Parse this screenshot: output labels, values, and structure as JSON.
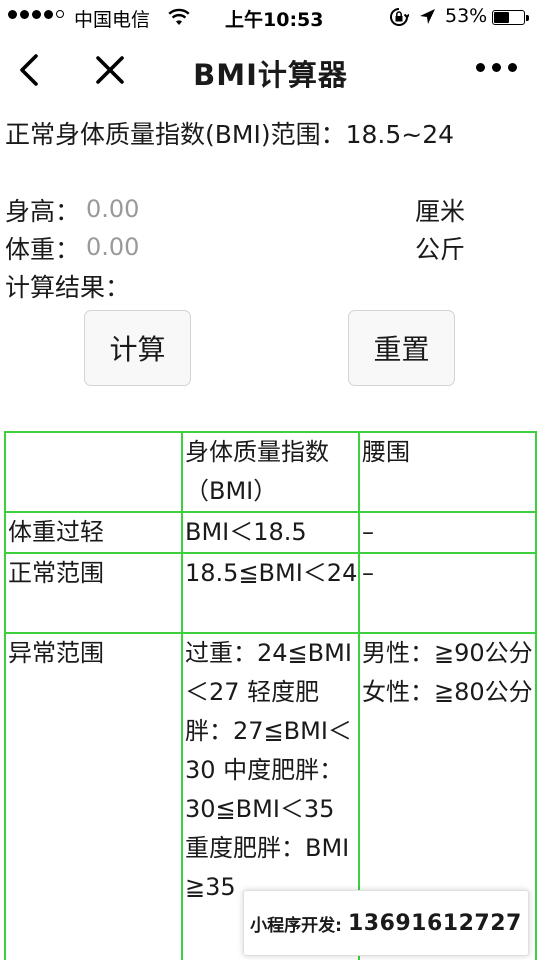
{
  "status_bar": {
    "signal_icon": "signal-dots-icon",
    "carrier": "中国电信",
    "wifi_icon": "wifi-icon",
    "time": "上午10:53",
    "lock_icon": "orientation-lock-icon",
    "location_icon": "location-arrow-icon",
    "battery_percent": "53%",
    "battery_level": 0.53
  },
  "nav": {
    "back_icon": "chevron-left-icon",
    "close_icon": "close-icon",
    "title": "BMI计算器",
    "more_icon": "more-dots-icon"
  },
  "info": {
    "range_text": "正常身体质量指数(BMI)范围：18.5~24"
  },
  "form": {
    "height_label": "身高：",
    "height_placeholder": "0.00",
    "height_unit": "厘米",
    "weight_label": "体重：",
    "weight_placeholder": "0.00",
    "weight_unit": "公斤",
    "result_label": "计算结果：",
    "calc_button": "计算",
    "reset_button": "重置"
  },
  "table": {
    "header": [
      "",
      "身体质量指数（BMI）",
      "腰围"
    ],
    "rows": [
      [
        "体重过轻",
        "BMI＜18.5",
        "–"
      ],
      [
        "正常范围",
        "18.5≦BMI＜24",
        "–"
      ],
      [
        "异常范围",
        "过重：24≦BMI＜27 轻度肥胖：27≦BMI＜30 中度肥胖：30≦BMI＜35 重度肥胖：BMI≧35",
        "男性：≧90公分 女性：≧80公分"
      ]
    ]
  },
  "footer": {
    "label": "小程序开发:",
    "phone": "13691612727"
  },
  "colors": {
    "table_border": "#3ecf3e",
    "placeholder": "#9a9a9a",
    "button_bg": "#f8f8f8"
  }
}
